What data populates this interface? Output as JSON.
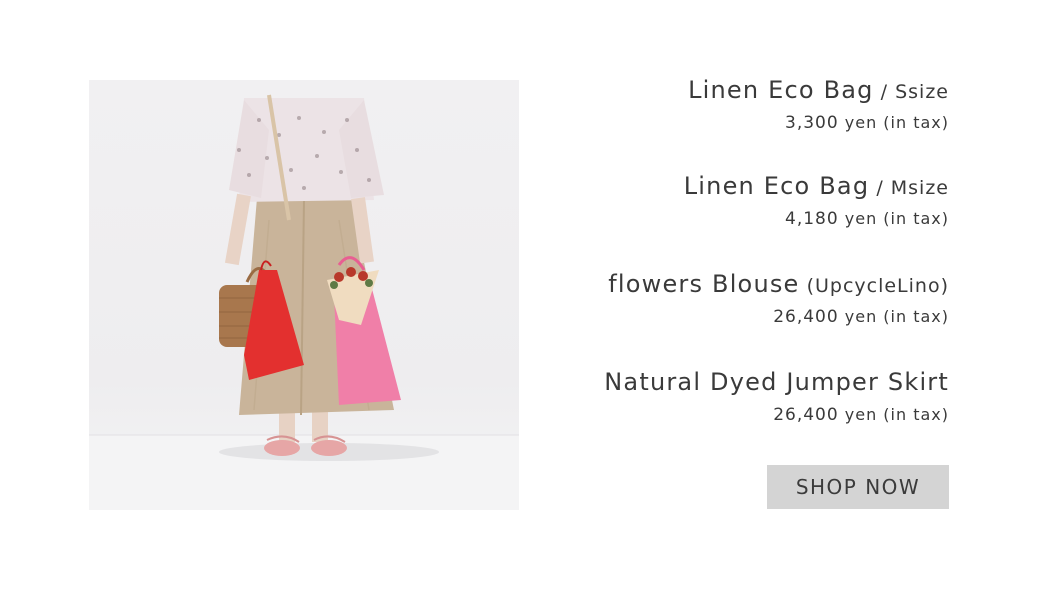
{
  "products": [
    {
      "name": "Linen Eco Bag",
      "suffix": " / Ssize",
      "price": "3,300",
      "unit": " yen (in tax)"
    },
    {
      "name": "Linen Eco Bag",
      "suffix": " / Msize",
      "price": "4,180",
      "unit": " yen (in tax)"
    },
    {
      "name": "flowers Blouse",
      "suffix": " (UpcycleLino)",
      "price": "26,400",
      "unit": " yen (in tax)"
    },
    {
      "name": "Natural Dyed Jumper Skirt",
      "suffix": "",
      "price": "26,400",
      "unit": " yen (in tax)"
    }
  ],
  "cta": {
    "label": "SHOP NOW"
  },
  "colors": {
    "button_bg": "#d4d4d4",
    "text": "#3a3a3a",
    "red_bag": "#e3302f",
    "pink_bag": "#f07fa8",
    "skirt": "#c9b49a"
  }
}
